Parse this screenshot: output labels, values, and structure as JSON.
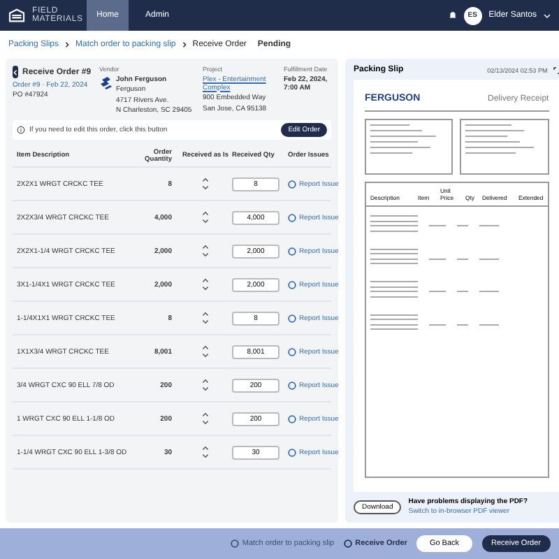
{
  "nav": {
    "logo": "FIELD MATERIALS",
    "tabs": [
      {
        "label": "Home",
        "selected": true
      },
      {
        "label": "Admin",
        "selected": false
      }
    ],
    "avatar": "ES",
    "user": "Elder Santos"
  },
  "breadcrumb": [
    "Packing Slips",
    "Match order to packing slip",
    "Receive Order"
  ],
  "status": "Pending",
  "order": {
    "title": "Receive Order #9",
    "meta": "Order #9 · Feb 22, 2024",
    "po": "PO #47924",
    "vendor": {
      "label": "Vendor",
      "lines": [
        "John Ferguson",
        "Ferguson",
        "4717 Rivers Ave.",
        "N Charleston, SC 29405"
      ]
    },
    "project": {
      "label": "Project",
      "link": "Plex - Entertainment Complex",
      "lines": [
        "900 Embedded Way",
        "San Jose, CA 95138"
      ]
    },
    "fulfillment": {
      "label": "Fulfillment Date",
      "value": "Feb 22, 2024, 7:00 AM"
    }
  },
  "info": {
    "text": "If you need to edit this order, click this button",
    "button": "Edit Order"
  },
  "table": {
    "columns": [
      "Item Description",
      "Order Quantity",
      "Received as Is",
      "Received Qty",
      "Order Issues"
    ],
    "rows": [
      {
        "item": "2X2X1 WRGT CRCKC TEE",
        "qty": "8",
        "received": "8",
        "issue": "Report Issue"
      },
      {
        "item": "2X2X3/4 WRGT CRCKC TEE",
        "qty": "4,000",
        "received": "4,000",
        "issue": "Report Issue"
      },
      {
        "item": "2X2X1-1/4 WRGT CRCKC TEE",
        "qty": "2,000",
        "received": "2,000",
        "issue": "Report Issue"
      },
      {
        "item": "3X1-1/4X1 WRGT CRCKC TEE",
        "qty": "2,000",
        "received": "2,000",
        "issue": "Report Issue"
      },
      {
        "item": "1-1/4X1X1 WRGT CRCKC TEE",
        "qty": "8",
        "received": "8",
        "issue": "Report Issue"
      },
      {
        "item": "1X1X3/4 WRGT CRCKC TEE",
        "qty": "8,001",
        "received": "8,001",
        "issue": "Report Issue"
      },
      {
        "item": "3/4 WRGT CXC 90 ELL 7/8 OD",
        "qty": "200",
        "received": "200",
        "issue": "Report Issue"
      },
      {
        "item": "1 WRGT CXC 90 ELL 1-1/8 OD",
        "qty": "200",
        "received": "200",
        "issue": "Report Issue"
      },
      {
        "item": "1-1/4 WRGT CXC 90 ELL 1-3/8 OD",
        "qty": "30",
        "received": "30",
        "issue": "Report Issue"
      }
    ]
  },
  "slip": {
    "title": "Packing Slip",
    "timestamp": "02/13/2024 02:53 PM",
    "brand": "FERGUSON",
    "doc_title": "Delivery Receipt",
    "columns": [
      "Description",
      "Item",
      "Unit Price",
      "Qty",
      "Delivered",
      "Extended"
    ],
    "download": "Download",
    "problem": "Have problems displaying the PDF?",
    "switch": "Switch to in-browser PDF viewer"
  },
  "footer": {
    "steps": [
      {
        "label": "Match order to packing slip",
        "selected": false
      },
      {
        "label": "Receive Order",
        "selected": true
      }
    ],
    "back": "Go Back",
    "submit": "Receive Order"
  }
}
